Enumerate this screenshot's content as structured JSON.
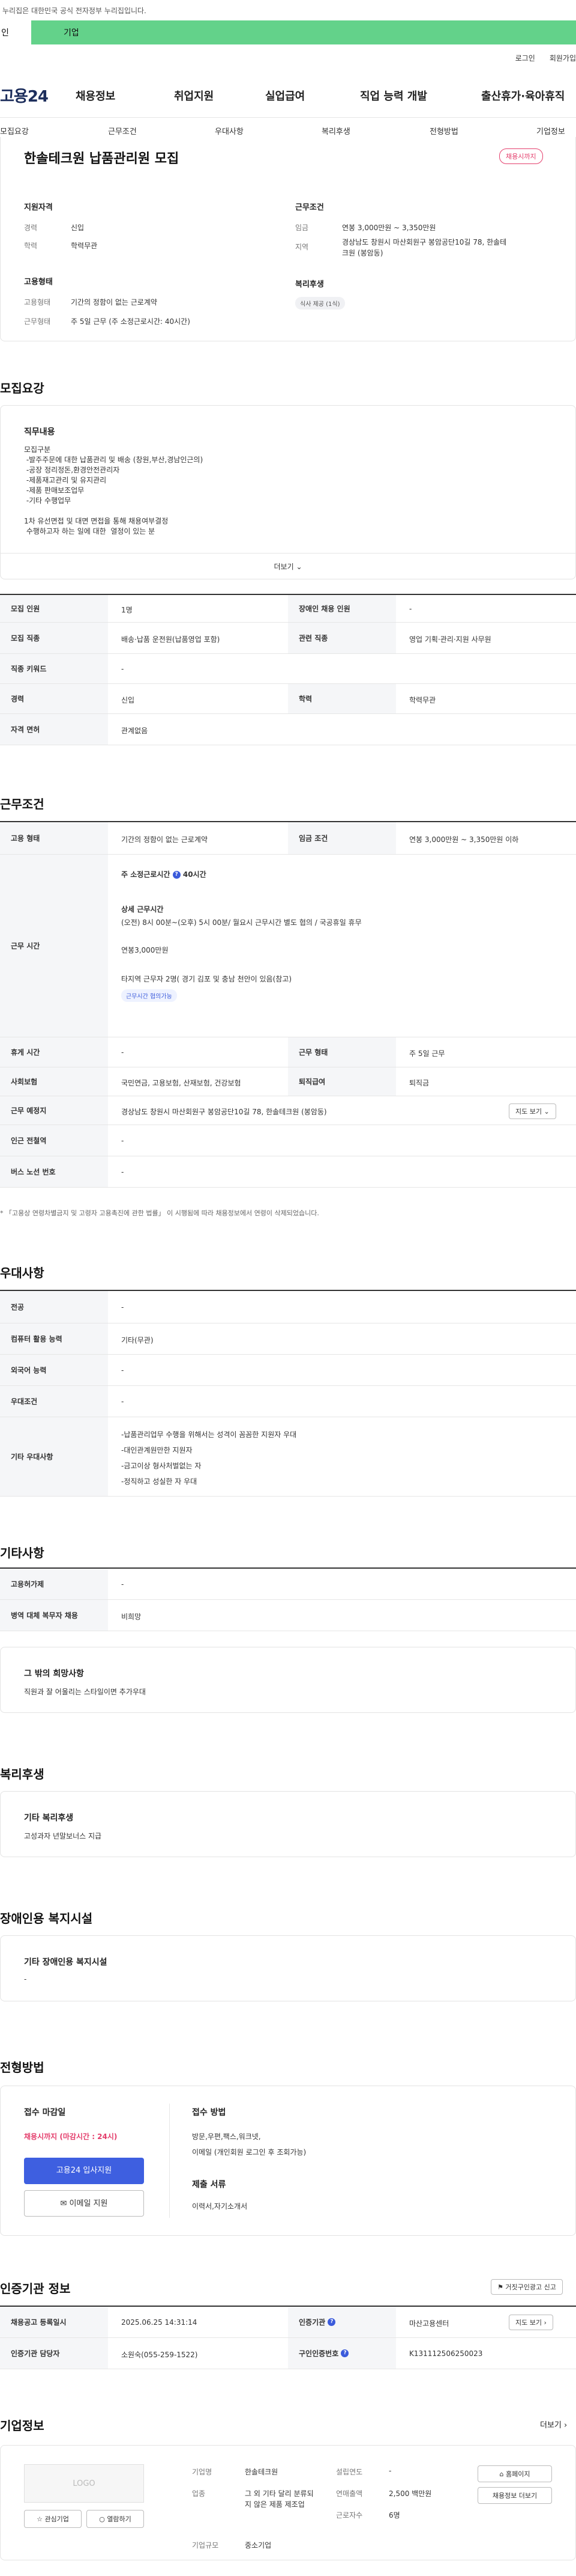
{
  "gov_notice": "누리집은 대한민국 공식 전자정부 누리집입니다.",
  "top_tabs": {
    "left": "인",
    "right": "기업"
  },
  "util": {
    "login": "로그인",
    "join": "회원가입"
  },
  "logo": "고용24",
  "gnb": [
    "채용정보",
    "취업지원",
    "실업급여",
    "직업 능력 개발",
    "출산휴가·육아휴직"
  ],
  "lnb": [
    "모집요강",
    "근무조건",
    "우대사항",
    "복리후생",
    "전형방법",
    "기업정보"
  ],
  "summary": {
    "title": "한솔테크원 납품관리원 모집",
    "status": "채용시까지",
    "qual_head": "지원자격",
    "career_k": "경력",
    "career_v": "신입",
    "edu_k": "학력",
    "edu_v": "학력무관",
    "emp_head": "고용형태",
    "emptype_k": "고용형태",
    "emptype_v": "기간의 정함이 없는 근로계약",
    "worktype_k": "근무형태",
    "worktype_v": "주 5일 근무 (주 소정근로시간: 40시간)",
    "cond_head": "근무조건",
    "wage_k": "임금",
    "wage_v": "연봉 3,000만원 ~ 3,350만원",
    "region_k": "지역",
    "region_v1": "경상남도 창원시 마산회원구 봉암공단10길 78, 한솔테",
    "region_v2": "크원 (봉암동)",
    "welfare_head": "복리후생",
    "welfare_chip": "식사 제공 (1식)"
  },
  "recruit": {
    "section": "모집요강",
    "duty_head": "직무내용",
    "duty_text": "모집구분\n -발주주문에 대한 납품관리 및 배송 (창원,부산,경남인근의)\n -공장 정리정돈,환경안전관리자\n -제품재고관리 및 유지관리\n -제품 판매보조업무\n -기타 수행업무\n\n1차 유선면접 및 대면 면접을 통해 채용여부결정\n 수행하고자 하는 일에 대한  열정이 있는 분",
    "more": "더보기",
    "rows": [
      [
        "모집 인원",
        "1명",
        "장애인 채용 인원",
        "-"
      ],
      [
        "모집 직종",
        "배송·납품 운전원(납품영업 포함)",
        "관련 직종",
        "영업 기획·관리·지원 사무원"
      ],
      [
        "직종 키워드",
        "-",
        "",
        ""
      ],
      [
        "경력",
        "신입",
        "학력",
        "학력무관"
      ],
      [
        "자격 면허",
        "관계없음",
        "",
        ""
      ]
    ]
  },
  "work": {
    "section": "근무조건",
    "emp_k": "고용 형태",
    "emp_v": "기간의 정함이 없는 근로계약",
    "wage_k": "임금 조건",
    "wage_v": "연봉 3,000만원 ~ 3,350만원 이하",
    "time_k": "근무 시간",
    "time_hours": "주 소정근로시간",
    "time_hours_v": "40시간",
    "time_detail_head": "상세 근무시간",
    "time_detail": "(오전) 8시 00분~(오후) 5시 00분/ 월요시 근무시간 별도 협의 / 국공휴일 휴무",
    "time_salary": "연봉3,000만원",
    "time_extra": "타지역 근무자 2명( 경기 김포 및 충남 천안이 있음(참고)",
    "time_tag": "근무시간 협의가능",
    "holiday_k": "휴게 시간",
    "holiday_v": "-",
    "shape_k": "근무 형태",
    "shape_v": "주 5일 근무",
    "ins_k": "사회보험",
    "ins_v": "국민연금, 고용보험, 산재보험, 건강보험",
    "ret_k": "퇴직급여",
    "ret_v": "퇴직금",
    "place_k": "근무 예정지",
    "place_v": "경상남도 창원시 마산회원구 봉암공단10길 78, 한솔테크원 (봉암동)",
    "map_btn": "지도 보기",
    "subway_k": "인근 전철역",
    "subway_v": "-",
    "bus_k": "버스 노선 번호",
    "bus_v": "-",
    "note": "* 「고용상 연령차별금지 및 고령자 고용촉진에 관한 법률」 이 시행됨에 따라 채용정보에서 연령이 삭제되었습니다."
  },
  "pref": {
    "section": "우대사항",
    "rows": [
      [
        "전공",
        "-"
      ],
      [
        "컴퓨터 활용 능력",
        "기타(무관)"
      ],
      [
        "외국어 능력",
        "-"
      ],
      [
        "우대조건",
        "-"
      ]
    ],
    "etc_k": "기타 우대사항",
    "etc_v": "-납품관리업무 수행을 위해서는 성격이 꼼꼼한 지원자 우대\n-대인관계원만한 지원자\n-금고이상 형사처벌없는 자\n-정직하고 성실한 자 우대"
  },
  "other": {
    "section": "기타사항",
    "rows": [
      [
        "고용허가제",
        "-"
      ],
      [
        "병역 대체 복무자 채용",
        "비희망"
      ]
    ],
    "hope_head": "그 밖의 희망사항",
    "hope_v": "직원과 잘 어울리는 스타일이면 추가우대"
  },
  "welfare": {
    "section": "복리후생",
    "head": "기타 복리후생",
    "v": "고성과자 년말보너스 지급"
  },
  "disabled": {
    "section": "장애인용 복지시설",
    "head": "기타 장애인용 복지시설",
    "v": "-"
  },
  "process": {
    "section": "전형방법",
    "deadline_head": "접수 마감일",
    "deadline_v": "채용시까지 (마감시간 : 24시)",
    "apply_btn": "고용24 입사지원",
    "email_btn": "이메일 지원",
    "method_head": "접수 방법",
    "method_v1": "방문,우편,팩스,워크넷,",
    "method_v2": "이메일 (개인회원 로그인 후 조회가능)",
    "docs_head": "제출 서류",
    "docs_v": "이력서,자기소개서"
  },
  "cert": {
    "section": "인증기관 정보",
    "report_btn": "거짓구인광고 신고",
    "reg_k": "채용공고 등록일시",
    "reg_v": "2025.06.25 14:31:14",
    "org_k": "인증기관",
    "org_v": "마산고용센터",
    "map_btn": "지도 보기",
    "mgr_k": "인증기관 담당자",
    "mgr_v": "소원숙(055-259-1522)",
    "id_k": "구인인증번호",
    "id_v": "K131112506250023"
  },
  "company": {
    "section": "기업정보",
    "more": "더보기",
    "logo": "LOGO",
    "fav_btn": "관심기업",
    "follow_btn": "열람하기",
    "name_k": "기업명",
    "name_v": "한솔테크원",
    "ind_k": "업종",
    "ind_v": "그 외 기타 달리 분류되지 않은 제품 제조업",
    "size_k": "기업규모",
    "size_v": "중소기업",
    "year_k": "설립연도",
    "year_v": "-",
    "sales_k": "연매출액",
    "sales_v": "2,500 백만원",
    "emp_k": "근로자수",
    "emp_v": "6명",
    "home_btn": "홈페이지",
    "jobs_btn": "채용정보 더보기"
  }
}
